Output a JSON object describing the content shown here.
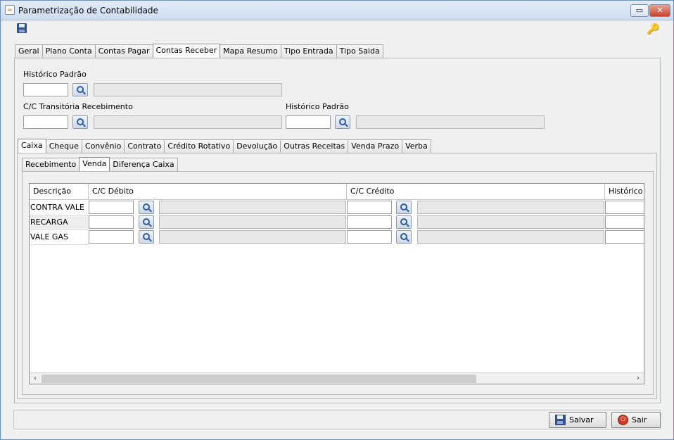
{
  "window": {
    "title": "Parametrização de Contabilidade",
    "icon": "java-cup-icon",
    "restore_glyph": "▭",
    "close_glyph": "✕"
  },
  "toolbar": {
    "save_icon": "floppy-icon",
    "key_icon": "key-icon",
    "key_glyph": "🔑"
  },
  "top_tabs": [
    "Geral",
    "Plano Conta",
    "Contas Pagar",
    "Contas Receber",
    "Mapa Resumo",
    "Tipo Entrada",
    "Tipo Saida"
  ],
  "top_tabs_active": "Contas Receber",
  "form": {
    "historico_padrao_label": "Histórico Padrão",
    "historico_padrao_code": "",
    "historico_padrao_desc": "",
    "cc_transitoria_label": "C/C Transitória Recebimento",
    "cc_transitoria_code": "",
    "cc_transitoria_desc": "",
    "historico_padrao2_label": "Histórico Padrão",
    "historico_padrao2_code": "",
    "historico_padrao2_desc": ""
  },
  "mid_tabs": [
    "Caixa",
    "Cheque",
    "Convênio",
    "Contrato",
    "Crédito Rotativo",
    "Devolução",
    "Outras Receitas",
    "Venda Prazo",
    "Verba"
  ],
  "mid_tabs_active": "Caixa",
  "sub_tabs": [
    "Recebimento",
    "Venda",
    "Diferença Caixa"
  ],
  "sub_tabs_active": "Venda",
  "grid": {
    "headers": {
      "descricao": "Descrição",
      "cc_debito": "C/C Débito",
      "cc_credito": "C/C Crédito",
      "historico": "Histórico Padrão"
    },
    "rows": [
      {
        "descricao": "CONTRA VALE"
      },
      {
        "descricao": "RECARGA"
      },
      {
        "descricao": "VALE GAS"
      }
    ],
    "scroll_left_glyph": "‹",
    "scroll_right_glyph": "›"
  },
  "actions": {
    "salvar_label": "Salvar",
    "sair_label": "Sair",
    "sair_glyph": "⏻"
  }
}
